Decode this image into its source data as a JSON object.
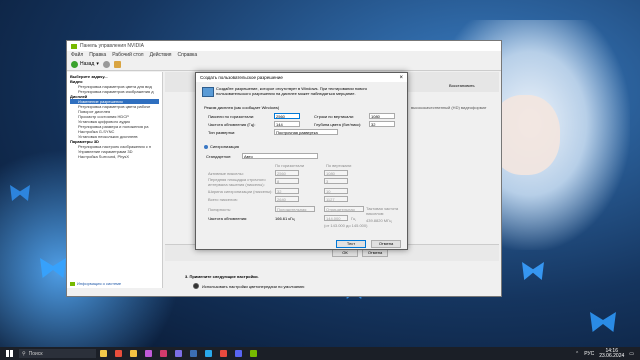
{
  "main_window": {
    "title": "Панель управления NVIDIA",
    "menu": [
      "Файл",
      "Правка",
      "Рабочий стол",
      "Действия",
      "Справка"
    ],
    "back_label": "Назад",
    "task_header": "Выберите задачу...",
    "tree": [
      {
        "label": "Видео",
        "group": true
      },
      {
        "label": "Регулировка параметров цвета для вид",
        "group": false
      },
      {
        "label": "Регулировка параметров изображения д",
        "group": false
      },
      {
        "label": "Дисплей",
        "group": true
      },
      {
        "label": "Изменение разрешения",
        "group": false,
        "selected": true
      },
      {
        "label": "Регулировка параметров цвета рабоче",
        "group": false
      },
      {
        "label": "Поворот дисплея",
        "group": false
      },
      {
        "label": "Просмотр состояния HDCP",
        "group": false
      },
      {
        "label": "Установка цифрового аудио",
        "group": false
      },
      {
        "label": "Регулировка размера и положения ра",
        "group": false
      },
      {
        "label": "Настройка G-SYNC",
        "group": false
      },
      {
        "label": "Установка нескольких дисплеев",
        "group": false
      },
      {
        "label": "Параметры 3D",
        "group": true
      },
      {
        "label": "Регулировка настроек изображения с п",
        "group": false
      },
      {
        "label": "Управление параметрами 3D",
        "group": false
      },
      {
        "label": "Настройка Surround, PhysX",
        "group": false
      }
    ],
    "sysinfo_link": "Информация о системе",
    "restore_label": "Восстановить",
    "right_text": "высококачественный (HD) видеоформат",
    "section3_title": "3. Примените следующие настройки.",
    "section3_option": "Использовать настройки цветопередачи по умолчанию",
    "ok_label": "ОК",
    "cancel_label": "Отмена"
  },
  "dialog": {
    "title": "Создать пользовательское разрешение",
    "description": "Создайте разрешение, которое отсутствует в Windows. При тестировании нового пользовательского разрешения на дисплее может наблюдаться мерцание.",
    "mode_label": "Режим дисплея (как сообщает Windows)",
    "horizontal_pixels_label": "Пиксели по горизонтали:",
    "horizontal_pixels_value": "2560",
    "vertical_lines_label": "Строки по вертикали:",
    "vertical_lines_value": "1080",
    "refresh_rate_label": "Частота обновления (Гц):",
    "refresh_rate_value": "144",
    "color_depth_label": "Глубина цвета (бит/пикс):",
    "color_depth_value": "32",
    "scan_type_label": "Тип развертки:",
    "scan_type_value": "Построчная развертка",
    "sync_label": "Синхронизация",
    "standard_label": "Стандартное:",
    "standard_value": "Авто",
    "col_horizontal": "По горизонтали",
    "col_vertical": "По вертикали",
    "active_pixels_label": "Активные пикселы:",
    "active_h": "2560",
    "active_v": "1080",
    "front_porch_label": "Передняя площадка строчного интервала гашения (пикселы):",
    "front_h": "8",
    "front_v": "3",
    "sync_width_label": "Ширина синхронизации (пикселы):",
    "width_h": "32",
    "width_v": "10",
    "total_pixels_label": "Всего пикселов:",
    "total_h": "2640",
    "total_v": "1127",
    "polarity_label": "Полярность:",
    "polarity_h": "Положительная",
    "polarity_v": "Отрицательная",
    "refresh_label": "Частота обновления:",
    "refresh_h": "166.61 кГц",
    "refresh_v": "144.000",
    "refresh_v_unit": "Гц",
    "pixel_clock_label": "Тактовая частота пикселов:",
    "pixel_clock_value": "439.8820 МГц",
    "range_text": "(от 143.000 до 145.000)",
    "test_label": "Тест",
    "cancel_label": "Отмена"
  },
  "taskbar": {
    "search_label": "Поиск",
    "lang": "РУС",
    "time": "14:16",
    "date": "23.06.2024"
  }
}
